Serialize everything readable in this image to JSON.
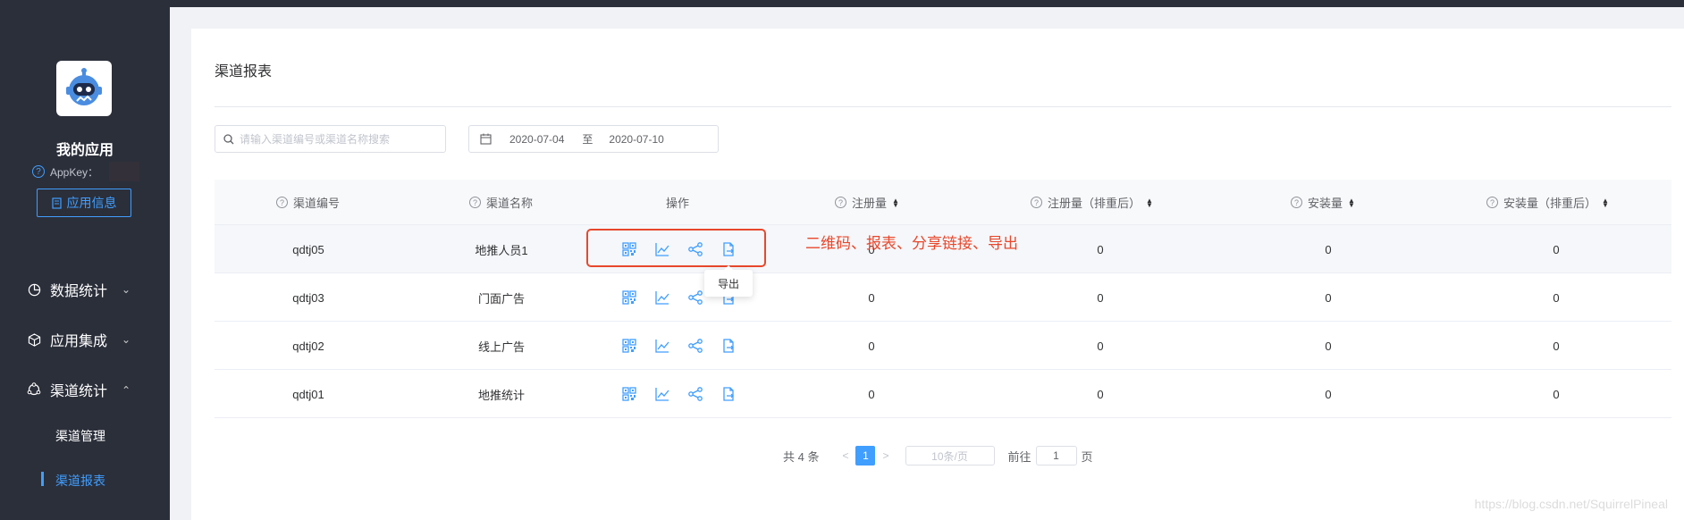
{
  "sidebar": {
    "app_name": "我的应用",
    "appkey_label": "AppKey：",
    "app_info_button": "应用信息",
    "menu": [
      {
        "label": "数据统计",
        "icon": "pie-chart-icon",
        "expanded": false
      },
      {
        "label": "应用集成",
        "icon": "cube-icon",
        "expanded": false
      },
      {
        "label": "渠道统计",
        "icon": "share-nodes-icon",
        "expanded": true
      }
    ],
    "submenu": [
      {
        "label": "渠道管理",
        "active": false
      },
      {
        "label": "渠道报表",
        "active": true
      }
    ]
  },
  "page": {
    "title": "渠道报表",
    "search_placeholder": "请输入渠道编号或渠道名称搜索",
    "date_start": "2020-07-04",
    "date_sep": "至",
    "date_end": "2020-07-10"
  },
  "table": {
    "headers": {
      "code": "渠道编号",
      "name": "渠道名称",
      "ops": "操作",
      "reg": "注册量",
      "reg_dedup": "注册量（排重后）",
      "install": "安装量",
      "install_dedup": "安装量（排重后）"
    },
    "rows": [
      {
        "code": "qdtj05",
        "name": "地推人员1",
        "reg": "0",
        "reg_dedup": "0",
        "install": "0",
        "install_dedup": "0"
      },
      {
        "code": "qdtj03",
        "name": "门面广告",
        "reg": "0",
        "reg_dedup": "0",
        "install": "0",
        "install_dedup": "0"
      },
      {
        "code": "qdtj02",
        "name": "线上广告",
        "reg": "0",
        "reg_dedup": "0",
        "install": "0",
        "install_dedup": "0"
      },
      {
        "code": "qdtj01",
        "name": "地推统计",
        "reg": "0",
        "reg_dedup": "0",
        "install": "0",
        "install_dedup": "0"
      }
    ],
    "op_icons": [
      "qrcode-icon",
      "line-chart-icon",
      "share-icon",
      "export-icon"
    ]
  },
  "annotation": {
    "text": "二维码、报表、分享链接、导出",
    "tooltip": "导出"
  },
  "pagination": {
    "total": "共 4 条",
    "current_page": "1",
    "page_size": "10条/页",
    "goto_label": "前往",
    "goto_value": "1",
    "page_suffix": "页"
  },
  "watermark": "https://blog.csdn.net/SquirrelPineal",
  "colors": {
    "primary": "#409eff",
    "sidebar_bg": "#2b2f3a",
    "annotation": "#e8472c"
  }
}
